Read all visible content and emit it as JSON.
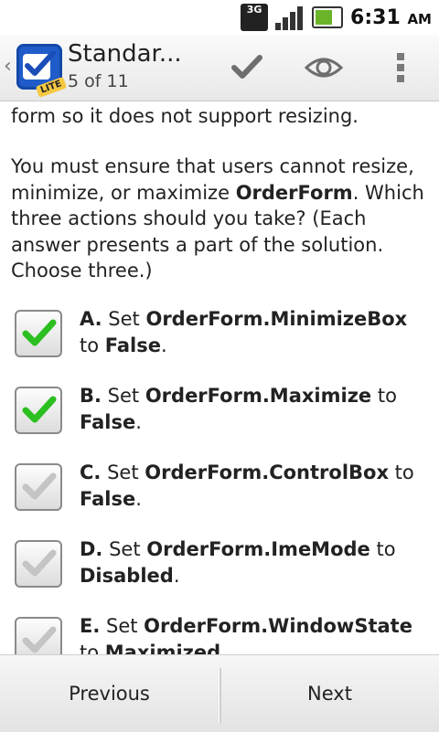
{
  "status_bar": {
    "network": "3G",
    "time": "6:31",
    "ampm": "AM"
  },
  "action_bar": {
    "app_badge": "LITE",
    "title": "Standar...",
    "subtitle": "5 of 11",
    "icons": [
      "check-icon",
      "eye-icon",
      "overflow-menu-icon"
    ]
  },
  "question": {
    "partial_line": "form so it does not support resizing.",
    "text_before": "You must ensure that users cannot resize, minimize, or maximize ",
    "bold_term": "OrderForm",
    "text_after": ". Which three actions should you take? (Each answer presents a part of the solution. Choose three.)"
  },
  "options": [
    {
      "letter": "A.",
      "pre": " Set ",
      "property": "OrderForm.MinimizeBox",
      "mid": " to ",
      "value": "False",
      "end": ".",
      "checked": true
    },
    {
      "letter": "B.",
      "pre": " Set ",
      "property": "OrderForm.Maximize",
      "mid": " to ",
      "value": "False",
      "end": ".",
      "checked": true
    },
    {
      "letter": "C.",
      "pre": " Set ",
      "property": "OrderForm.ControlBox",
      "mid": " to ",
      "value": "False",
      "end": ".",
      "checked": false
    },
    {
      "letter": "D.",
      "pre": " Set ",
      "property": "OrderForm.ImeMode",
      "mid": " to ",
      "value": "Disabled",
      "end": ".",
      "checked": false
    },
    {
      "letter": "E.",
      "pre": " Set ",
      "property": "OrderForm.WindowState",
      "mid": " to ",
      "value": "Maximized",
      "end": ".",
      "checked": false
    }
  ],
  "bottom_bar": {
    "previous_label": "Previous",
    "next_label": "Next"
  },
  "colors": {
    "check_green": "#2bbf1f",
    "check_gray": "#c4c4c4",
    "app_blue": "#1f5cc9"
  }
}
